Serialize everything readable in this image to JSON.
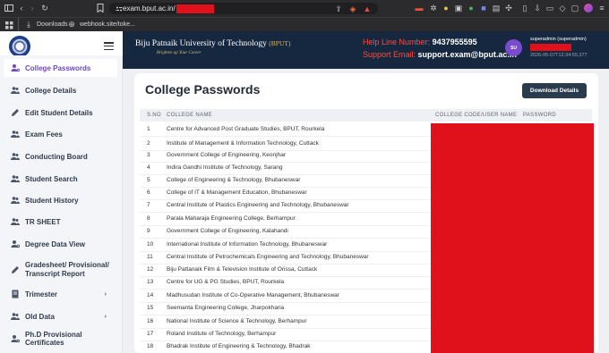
{
  "browser": {
    "url_text": "exam.bput.ac.in/",
    "bookmarks": [
      "Downloads",
      "webhook.site/toke..."
    ]
  },
  "header": {
    "university_name": "Biju Patnaik University of Technology",
    "university_abbr": "(BPUT)",
    "tagline": "Brighten up Your Career",
    "helpline_label": "Help Line Number:",
    "helpline_number": "9437955595",
    "support_label": "Support Email:",
    "support_email": "support.exam@bput.ac.in",
    "avatar_initials": "SU",
    "user_name": "superadmin (superadmin)",
    "timestamp": "2026-05-07T12:34:55.377"
  },
  "sidebar": {
    "items": [
      {
        "label": "College Passwords",
        "icon": "user-key-icon",
        "active": true
      },
      {
        "label": "College Details",
        "icon": "users-icon"
      },
      {
        "label": "Edit Student Details",
        "icon": "pencil-icon"
      },
      {
        "label": "Exam Fees",
        "icon": "users-icon"
      },
      {
        "label": "Conducting Board",
        "icon": "users-icon"
      },
      {
        "label": "Student Search",
        "icon": "users-icon"
      },
      {
        "label": "Student History",
        "icon": "users-icon"
      },
      {
        "label": "TR SHEET",
        "icon": "users-icon"
      },
      {
        "label": "Degree Data View",
        "icon": "user-key-icon"
      },
      {
        "label": "Gradesheet/ Provisional/",
        "label2": "Transcript Report",
        "icon": "pencil-icon"
      },
      {
        "label": "Trimester",
        "icon": "document-icon",
        "chevron": true
      },
      {
        "label": "Old Data",
        "icon": "users-icon",
        "chevron": true
      },
      {
        "label": "Ph.D Provisional Certificates",
        "icon": "user-key-icon"
      }
    ]
  },
  "main": {
    "title": "College Passwords",
    "download_button": "Download Details",
    "columns": {
      "sno": "S.NO",
      "college_name": "COLLEGE NAME",
      "college_code": "COLLEGE CODE/USER NAME",
      "password": "PASSWORD"
    },
    "rows": [
      {
        "sno": "1",
        "name": "Centre for Advanced Post Graduate Studies, BPUT, Rourkela"
      },
      {
        "sno": "2",
        "name": "Institute of Management & Information Technology, Cuttack"
      },
      {
        "sno": "3",
        "name": "Government College of Engineering, Keonjhar"
      },
      {
        "sno": "4",
        "name": "Indira Gandhi Institute of Technology, Sarang"
      },
      {
        "sno": "5",
        "name": "College of Engineering & Technology, Bhubaneswar"
      },
      {
        "sno": "6",
        "name": "College of IT & Management Education, Bhubaneswar"
      },
      {
        "sno": "7",
        "name": "Central Institute of Plastics Engineering and Technology, Bhubaneswar"
      },
      {
        "sno": "8",
        "name": "Parala Maharaja Engineering College, Berhampur"
      },
      {
        "sno": "9",
        "name": "Government College of Engineering, Kalahandi"
      },
      {
        "sno": "10",
        "name": "International Institute of Information Technology, Bhubaneswar"
      },
      {
        "sno": "11",
        "name": "Central Institute of Petrochemicals Engineering and Technology, Bhubaneswar"
      },
      {
        "sno": "12",
        "name": "Biju Pattanaik Film & Television Institute of Orissa, Cuttack"
      },
      {
        "sno": "13",
        "name": "Centre for UG & PG Studies, BPUT, Rourkela"
      },
      {
        "sno": "14",
        "name": "Madhusudan Institute of Co-Operative Management, Bhubaneswar"
      },
      {
        "sno": "15",
        "name": "Seemanta Engineering College, Jharpokharia"
      },
      {
        "sno": "16",
        "name": "National Institute of Science & Technology, Berhampur"
      },
      {
        "sno": "17",
        "name": "Roland Institute of Technology, Berhampur"
      },
      {
        "sno": "18",
        "name": "Bhadrak Institute of Engineering & Technology, Bhadrak"
      }
    ]
  },
  "colors": {
    "header_bg": "#162840",
    "accent_purple": "#6f47c4",
    "redaction": "#e0111b",
    "help_label": "#ff4a3d"
  }
}
